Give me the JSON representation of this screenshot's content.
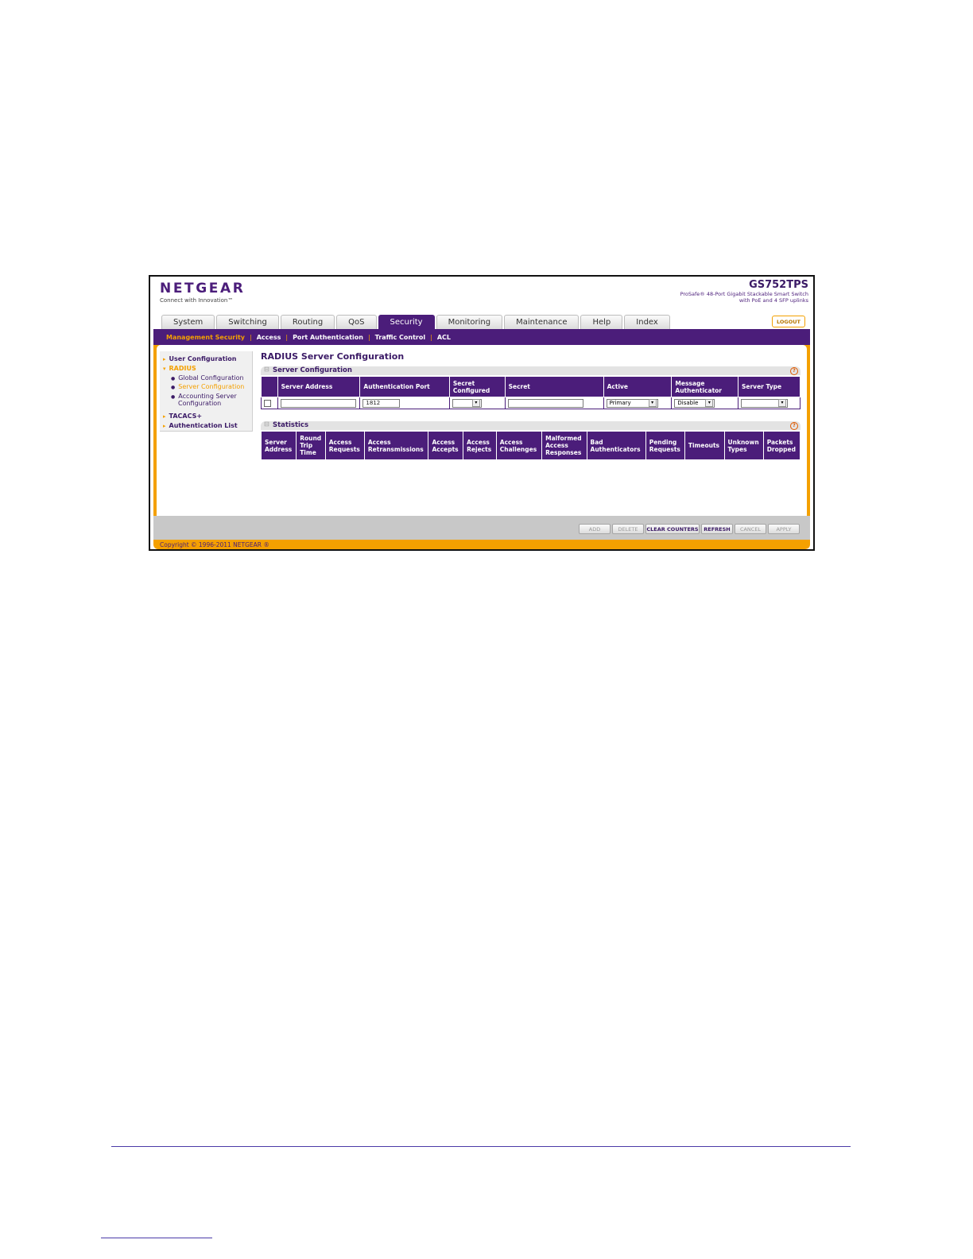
{
  "header": {
    "brand": "NETGEAR",
    "tagline": "Connect with Innovation™",
    "model": "GS752TPS",
    "desc_line1": "ProSafe® 48-Port Gigabit Stackable Smart Switch",
    "desc_line2": "with PoE and 4 SFP uplinks"
  },
  "tabs": [
    {
      "label": "System"
    },
    {
      "label": "Switching"
    },
    {
      "label": "Routing"
    },
    {
      "label": "QoS"
    },
    {
      "label": "Security",
      "active": true
    },
    {
      "label": "Monitoring"
    },
    {
      "label": "Maintenance"
    },
    {
      "label": "Help"
    },
    {
      "label": "Index"
    }
  ],
  "logout_label": "LOGOUT",
  "subnav": [
    {
      "label": "Management Security",
      "active": true
    },
    {
      "label": "Access"
    },
    {
      "label": "Port Authentication"
    },
    {
      "label": "Traffic Control"
    },
    {
      "label": "ACL"
    }
  ],
  "sidebar": {
    "user_configuration": "User Configuration",
    "radius": "RADIUS",
    "global_configuration": "Global Configuration",
    "server_configuration": "Server Configuration",
    "accounting_server_1": "Accounting Server",
    "accounting_server_2": "Configuration",
    "tacacs": "TACACS+",
    "authentication_list": "Authentication List"
  },
  "page_title": "RADIUS Server Configuration",
  "server_config": {
    "section_title": "Server Configuration",
    "columns": [
      "Server Address",
      "Authentication Port",
      "Secret Configured",
      "Secret",
      "Active",
      "Message Authenticator",
      "Server Type"
    ],
    "row": {
      "server_address": "",
      "auth_port": "1812",
      "secret_configured": "",
      "secret": "",
      "active": "Primary",
      "message_authenticator": "Disable",
      "server_type": ""
    }
  },
  "statistics": {
    "section_title": "Statistics",
    "columns": [
      "Server Address",
      "Round Trip Time",
      "Access Requests",
      "Access Retransmissions",
      "Access Accepts",
      "Access Rejects",
      "Access Challenges",
      "Malformed Access Responses",
      "Bad Authenticators",
      "Pending Requests",
      "Timeouts",
      "Unknown Types",
      "Packets Dropped"
    ]
  },
  "buttons": {
    "add": "ADD",
    "delete": "DELETE",
    "clear_counters": "CLEAR COUNTERS",
    "refresh": "REFRESH",
    "cancel": "CANCEL",
    "apply": "APPLY"
  },
  "copyright": "Copyright © 1996-2011 NETGEAR ®",
  "icons": {
    "help": "?",
    "collapse": "⊟",
    "dropdown": "▾",
    "triangle": "▸",
    "bullet": "●"
  },
  "colors": {
    "purple": "#4b1d7a",
    "orange": "#f4a000",
    "grey": "#c8c8c8"
  }
}
